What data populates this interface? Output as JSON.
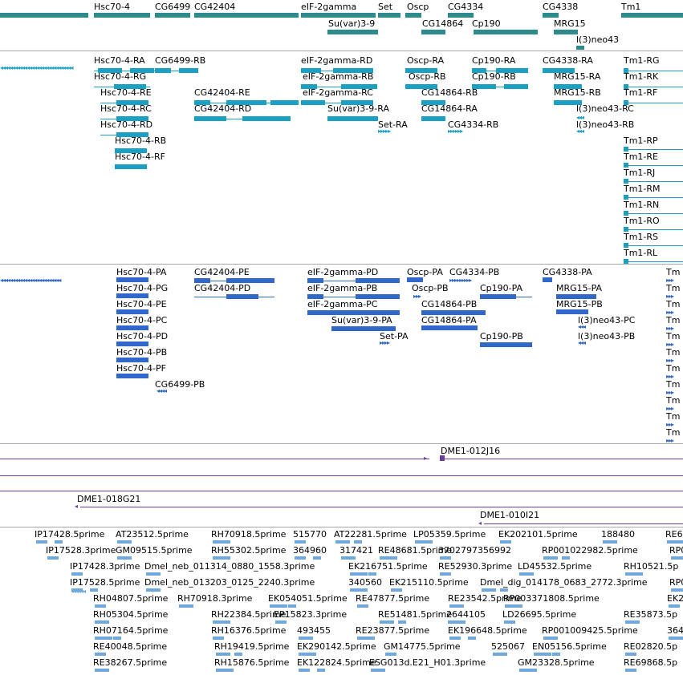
{
  "colors": {
    "overview": "#2e8b8b",
    "transcript": "#1aa0c2",
    "cds": "#3067c8",
    "clone": "#6a3f9a",
    "est": "#6ea8dc",
    "separator": "#a9a9a9"
  },
  "tracks": {
    "genes_overview": {
      "labels": [
        "Hsc70-4",
        "CG6499",
        "CG42404",
        "eIF-2gamma",
        "Set",
        "Oscp",
        "CG4334",
        "CG4338",
        "Tm1",
        "Su(var)3-9",
        "CG14864",
        "Cp190",
        "MRG15",
        "l(3)neo43"
      ]
    },
    "transcripts": {
      "labels": [
        "Hsc70-4-RA",
        "CG6499-RB",
        "eIF-2gamma-RD",
        "Oscp-RA",
        "Cp190-RA",
        "CG4338-RA",
        "Tm1-RG",
        "Hsc70-4-RG",
        "eIF-2gamma-RB",
        "Oscp-RB",
        "Cp190-RB",
        "MRG15-RA",
        "Tm1-RK",
        "Hsc70-4-RE",
        "CG42404-RE",
        "eIF-2gamma-RC",
        "CG14864-RB",
        "MRG15-RB",
        "Tm1-RF",
        "Hsc70-4-RC",
        "CG42404-RD",
        "Su(var)3-9-RA",
        "CG14864-RA",
        "l(3)neo43-RC",
        "Hsc70-4-RD",
        "Set-RA",
        "CG4334-RB",
        "l(3)neo43-RB",
        "Hsc70-4-RB",
        "Hsc70-4-RF",
        "Tm1-RP",
        "Tm1-RE",
        "Tm1-RJ",
        "Tm1-RM",
        "Tm1-RN",
        "Tm1-RO",
        "Tm1-RS",
        "Tm1-RL"
      ]
    },
    "proteins": {
      "labels": [
        "Hsc70-4-PA",
        "CG42404-PE",
        "eIF-2gamma-PD",
        "Oscp-PA",
        "CG4334-PB",
        "CG4338-PA",
        "Tm",
        "Hsc70-4-PG",
        "CG42404-PD",
        "eIF-2gamma-PB",
        "Oscp-PB",
        "Cp190-PA",
        "MRG15-PA",
        "Hsc70-4-PE",
        "eIF-2gamma-PC",
        "CG14864-PB",
        "MRG15-PB",
        "Hsc70-4-PC",
        "Su(var)3-9-PA",
        "CG14864-PA",
        "l(3)neo43-PC",
        "Hsc70-4-PD",
        "Set-PA",
        "Cp190-PB",
        "l(3)neo43-PB",
        "Hsc70-4-PB",
        "Hsc70-4-PF",
        "CG6499-PB"
      ]
    },
    "clones": {
      "labels": [
        "DME1-012J16",
        "DME1-018G21",
        "DME1-010I21"
      ]
    },
    "ests": {
      "labels": [
        "IP17428.5prime",
        "AT23512.5prime",
        "RH70918.5prime",
        "515770",
        "AT22281.5prime",
        "LP05359.5prime",
        "EK202101.5prime",
        "188480",
        "RE6",
        "IP17528.3prime",
        "GM09515.5prime",
        "RH55302.5prime",
        "364960",
        "317421",
        "RE48681.5prime",
        "3702797356992",
        "RP001022982.5prime",
        "RP0",
        "IP17428.3prime",
        "Dmel_neb_011314_0880_1558.3prime",
        "EK216751.5prime",
        "RE52930.3prime",
        "LD45532.5prime",
        "RH10521.5p",
        "IP17528.5prime",
        "Dmel_neb_013203_0125_2240.3prime",
        "340560",
        "EK215110.5prime",
        "Dmel_dig_014178_0683_2772.3prime",
        "RP0",
        "RH04807.5prime",
        "RH70918.3prime",
        "EK054051.5prime",
        "RE47877.5prime",
        "RE23542.5prime",
        "RP003371808.5prime",
        "EK2",
        "RH05304.5prime",
        "RH22384.5prime",
        "EP15823.3prime",
        "RE51481.5prime",
        "2644105",
        "LD26695.5prime",
        "RE35873.5p",
        "RH07164.5prime",
        "RH16376.5prime",
        "493455",
        "RE23877.5prime",
        "EK196648.5prime",
        "RP001009425.5prime",
        "364",
        "RE40048.5prime",
        "RH19419.5prime",
        "EK290142.5prime",
        "GM14775.5prime",
        "525067",
        "EN05156.5prime",
        "RE02820.5p",
        "RE38267.5prime",
        "RH15876.5prime",
        "EK122824.5prime",
        "ESG013d.E21_H01.3prime",
        "GM23328.5prime",
        "RE69868.5p"
      ]
    }
  }
}
